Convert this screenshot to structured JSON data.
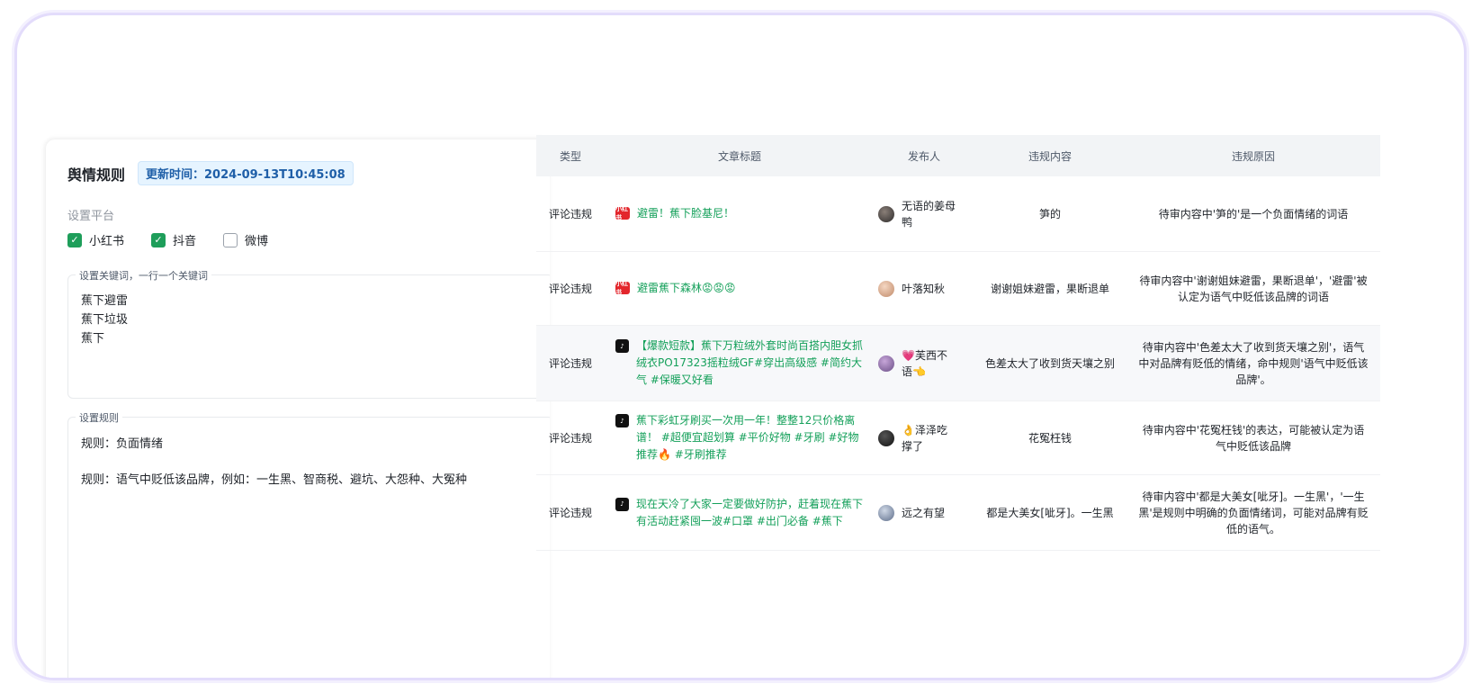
{
  "rules_panel": {
    "title": "舆情规则",
    "update_time": "更新时间：2024-09-13T10:45:08",
    "platform_label": "设置平台",
    "platforms": [
      {
        "label": "小红书",
        "checked": true
      },
      {
        "label": "抖音",
        "checked": true
      },
      {
        "label": "微博",
        "checked": false
      }
    ],
    "keywords_legend": "设置关键词，一行一个关键词",
    "keywords": [
      "蕉下避雷",
      "蕉下垃圾",
      "蕉下"
    ],
    "rules_legend": "设置规则",
    "rules": [
      "规则：负面情绪",
      "规则：语气中贬低该品牌，例如：一生黑、智商税、避坑、大怨种、大冤种"
    ]
  },
  "table": {
    "headers": [
      "类型",
      "文章标题",
      "发布人",
      "违规内容",
      "违规原因"
    ],
    "rows": [
      {
        "type": "评论违规",
        "platform_icon": "xiaohongshu-icon",
        "title": "避雷！蕉下脸基尼！",
        "publisher": "无语的姜母鸭",
        "content": "笋的",
        "reason": "待审内容中'笋的'是一个负面情绪的词语"
      },
      {
        "type": "评论违规",
        "platform_icon": "xiaohongshu-icon",
        "title": "避雷蕉下森林😡😡😡",
        "publisher": "叶落知秋",
        "content": "谢谢姐妹避雷，果断退单",
        "reason": "待审内容中'谢谢姐妹避雷，果断退单'，'避雷'被认定为语气中贬低该品牌的词语"
      },
      {
        "type": "评论违规",
        "platform_icon": "douyin-icon",
        "title": "【爆款短款】蕉下万粒绒外套时尚百搭内胆女抓绒衣PO17323摇粒绒GF#穿出高级感 #简约大气 #保暖又好看",
        "publisher": "💗芙西不语👈",
        "content": "色差太大了收到货天壤之别",
        "reason": "待审内容中'色差太大了收到货天壤之别'，语气中对品牌有贬低的情绪，命中规则'语气中贬低该品牌'。"
      },
      {
        "type": "评论违规",
        "platform_icon": "douyin-icon",
        "title": "蕉下彩虹牙刷买一次用一年！整整12只价格离谱！ #超便宜超划算 #平价好物 #牙刷 #好物推荐🔥 #牙刷推荐",
        "publisher": "👌泽泽吃撑了",
        "content": "花冤枉钱",
        "reason": "待审内容中'花冤枉钱'的表达，可能被认定为语气中贬低该品牌"
      },
      {
        "type": "评论违规",
        "platform_icon": "douyin-icon",
        "title": "现在天冷了大家一定要做好防护，赶着现在蕉下有活动赶紧囤一波#口罩 #出门必备 #蕉下",
        "publisher": "远之有望",
        "content": "都是大美女[呲牙]。一生黑",
        "reason": "待审内容中'都是大美女[呲牙]。一生黑'，'一生黑'是规则中明确的负面情绪词，可能对品牌有贬低的语气。"
      }
    ]
  },
  "icons": {
    "xiaohongshu": "小红书",
    "douyin": "♪"
  },
  "colors": {
    "accent_green": "#14a05a",
    "checkbox_green": "#1e9e5a",
    "frame_border": "#e3dcfb",
    "header_bg": "#f2f4f6"
  }
}
